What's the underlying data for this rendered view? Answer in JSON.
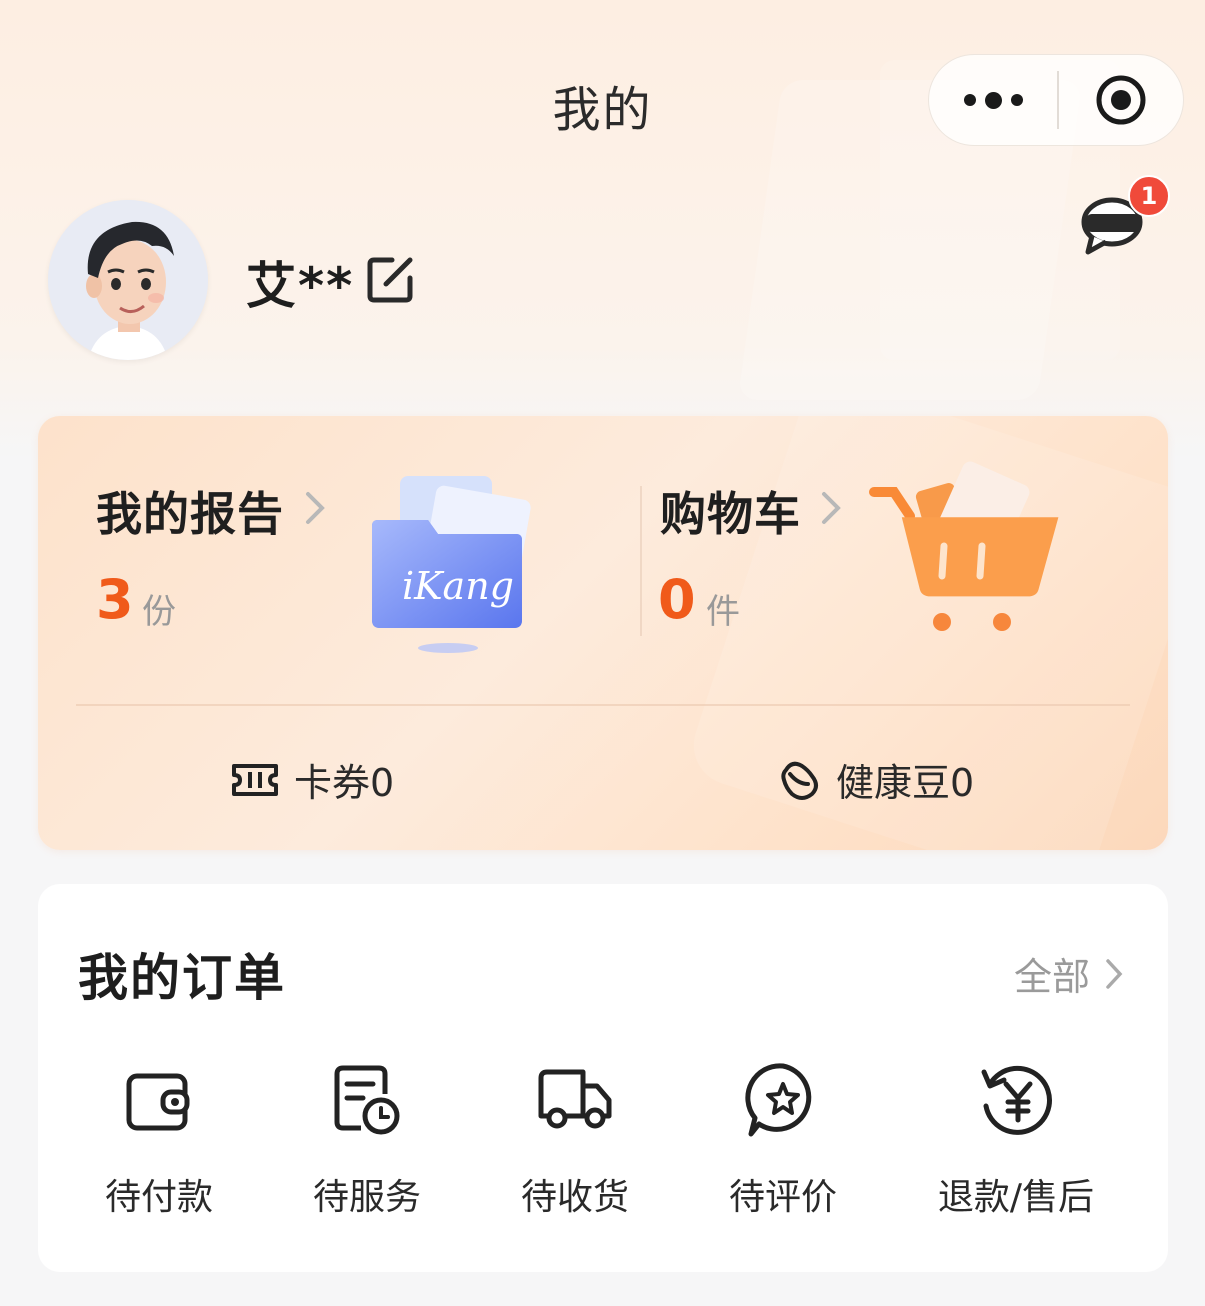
{
  "nav": {
    "title": "我的"
  },
  "capsule": {
    "more_icon": "more-dots-icon",
    "close_icon": "target-circle-icon"
  },
  "messages": {
    "badge": "1",
    "icon": "chat-bubble-icon"
  },
  "profile": {
    "name": "艾**",
    "edit_icon": "edit-icon"
  },
  "summary": {
    "report": {
      "title": "我的报告",
      "count": "3",
      "unit": "份",
      "illustration_text": "iKang"
    },
    "cart": {
      "title": "购物车",
      "count": "0",
      "unit": "件"
    },
    "coupons": {
      "label": "卡券0",
      "icon": "ticket-icon"
    },
    "health_beans": {
      "label": "健康豆0",
      "icon": "bean-icon"
    }
  },
  "orders": {
    "title": "我的订单",
    "all_label": "全部",
    "items": [
      {
        "label": "待付款",
        "icon": "wallet-icon"
      },
      {
        "label": "待服务",
        "icon": "document-clock-icon"
      },
      {
        "label": "待收货",
        "icon": "truck-icon"
      },
      {
        "label": "待评价",
        "icon": "star-bubble-icon"
      },
      {
        "label": "退款/售后",
        "icon": "refund-yen-icon"
      }
    ]
  },
  "colors": {
    "accent": "#f05a1a",
    "badge": "#f04a3a",
    "card_bg": "#fde2cb"
  }
}
